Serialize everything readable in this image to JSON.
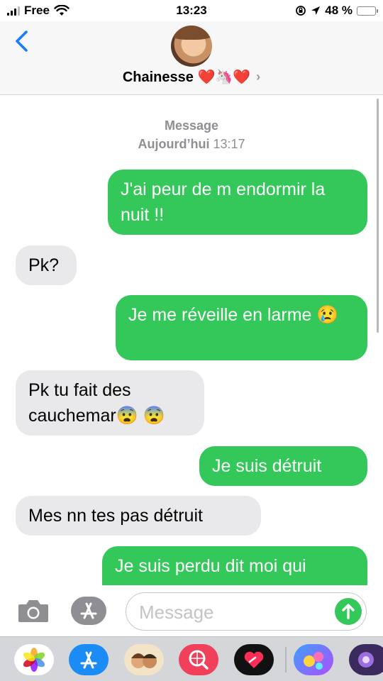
{
  "status": {
    "carrier": "Free",
    "time": "13:23",
    "battery": "48 %",
    "battery_level": 0.48
  },
  "header": {
    "back_icon": "chevron-left-icon",
    "contact_name": "Chainesse ❤️🦄❤️",
    "chevron": "›"
  },
  "thread": {
    "service": "Message",
    "date": "Aujourd’hui",
    "time": "13:17",
    "messages": [
      {
        "dir": "out",
        "text": "J'ai peur de m endormir la nuit !!"
      },
      {
        "dir": "in",
        "text": "Pk?"
      },
      {
        "dir": "out",
        "text": "Je me réveille en larme 😢"
      },
      {
        "dir": "in",
        "text": "Pk tu fait des cauchemar😨 😨"
      },
      {
        "dir": "out",
        "text": "Je suis détruit"
      },
      {
        "dir": "in",
        "text": "Mes nn tes pas détruit"
      },
      {
        "dir": "out",
        "text": "Je suis perdu dit moi qui"
      }
    ]
  },
  "input": {
    "placeholder": "Message"
  },
  "colors": {
    "outgoing": "#34c759",
    "incoming": "#e9e9eb",
    "accent": "#1a7cf7"
  },
  "drawer": {
    "apps": [
      "photos-icon",
      "app-store-icon",
      "memoji-icon",
      "web-search-icon",
      "digital-touch-icon",
      "game-app-icon",
      "game-app-2-icon"
    ]
  }
}
